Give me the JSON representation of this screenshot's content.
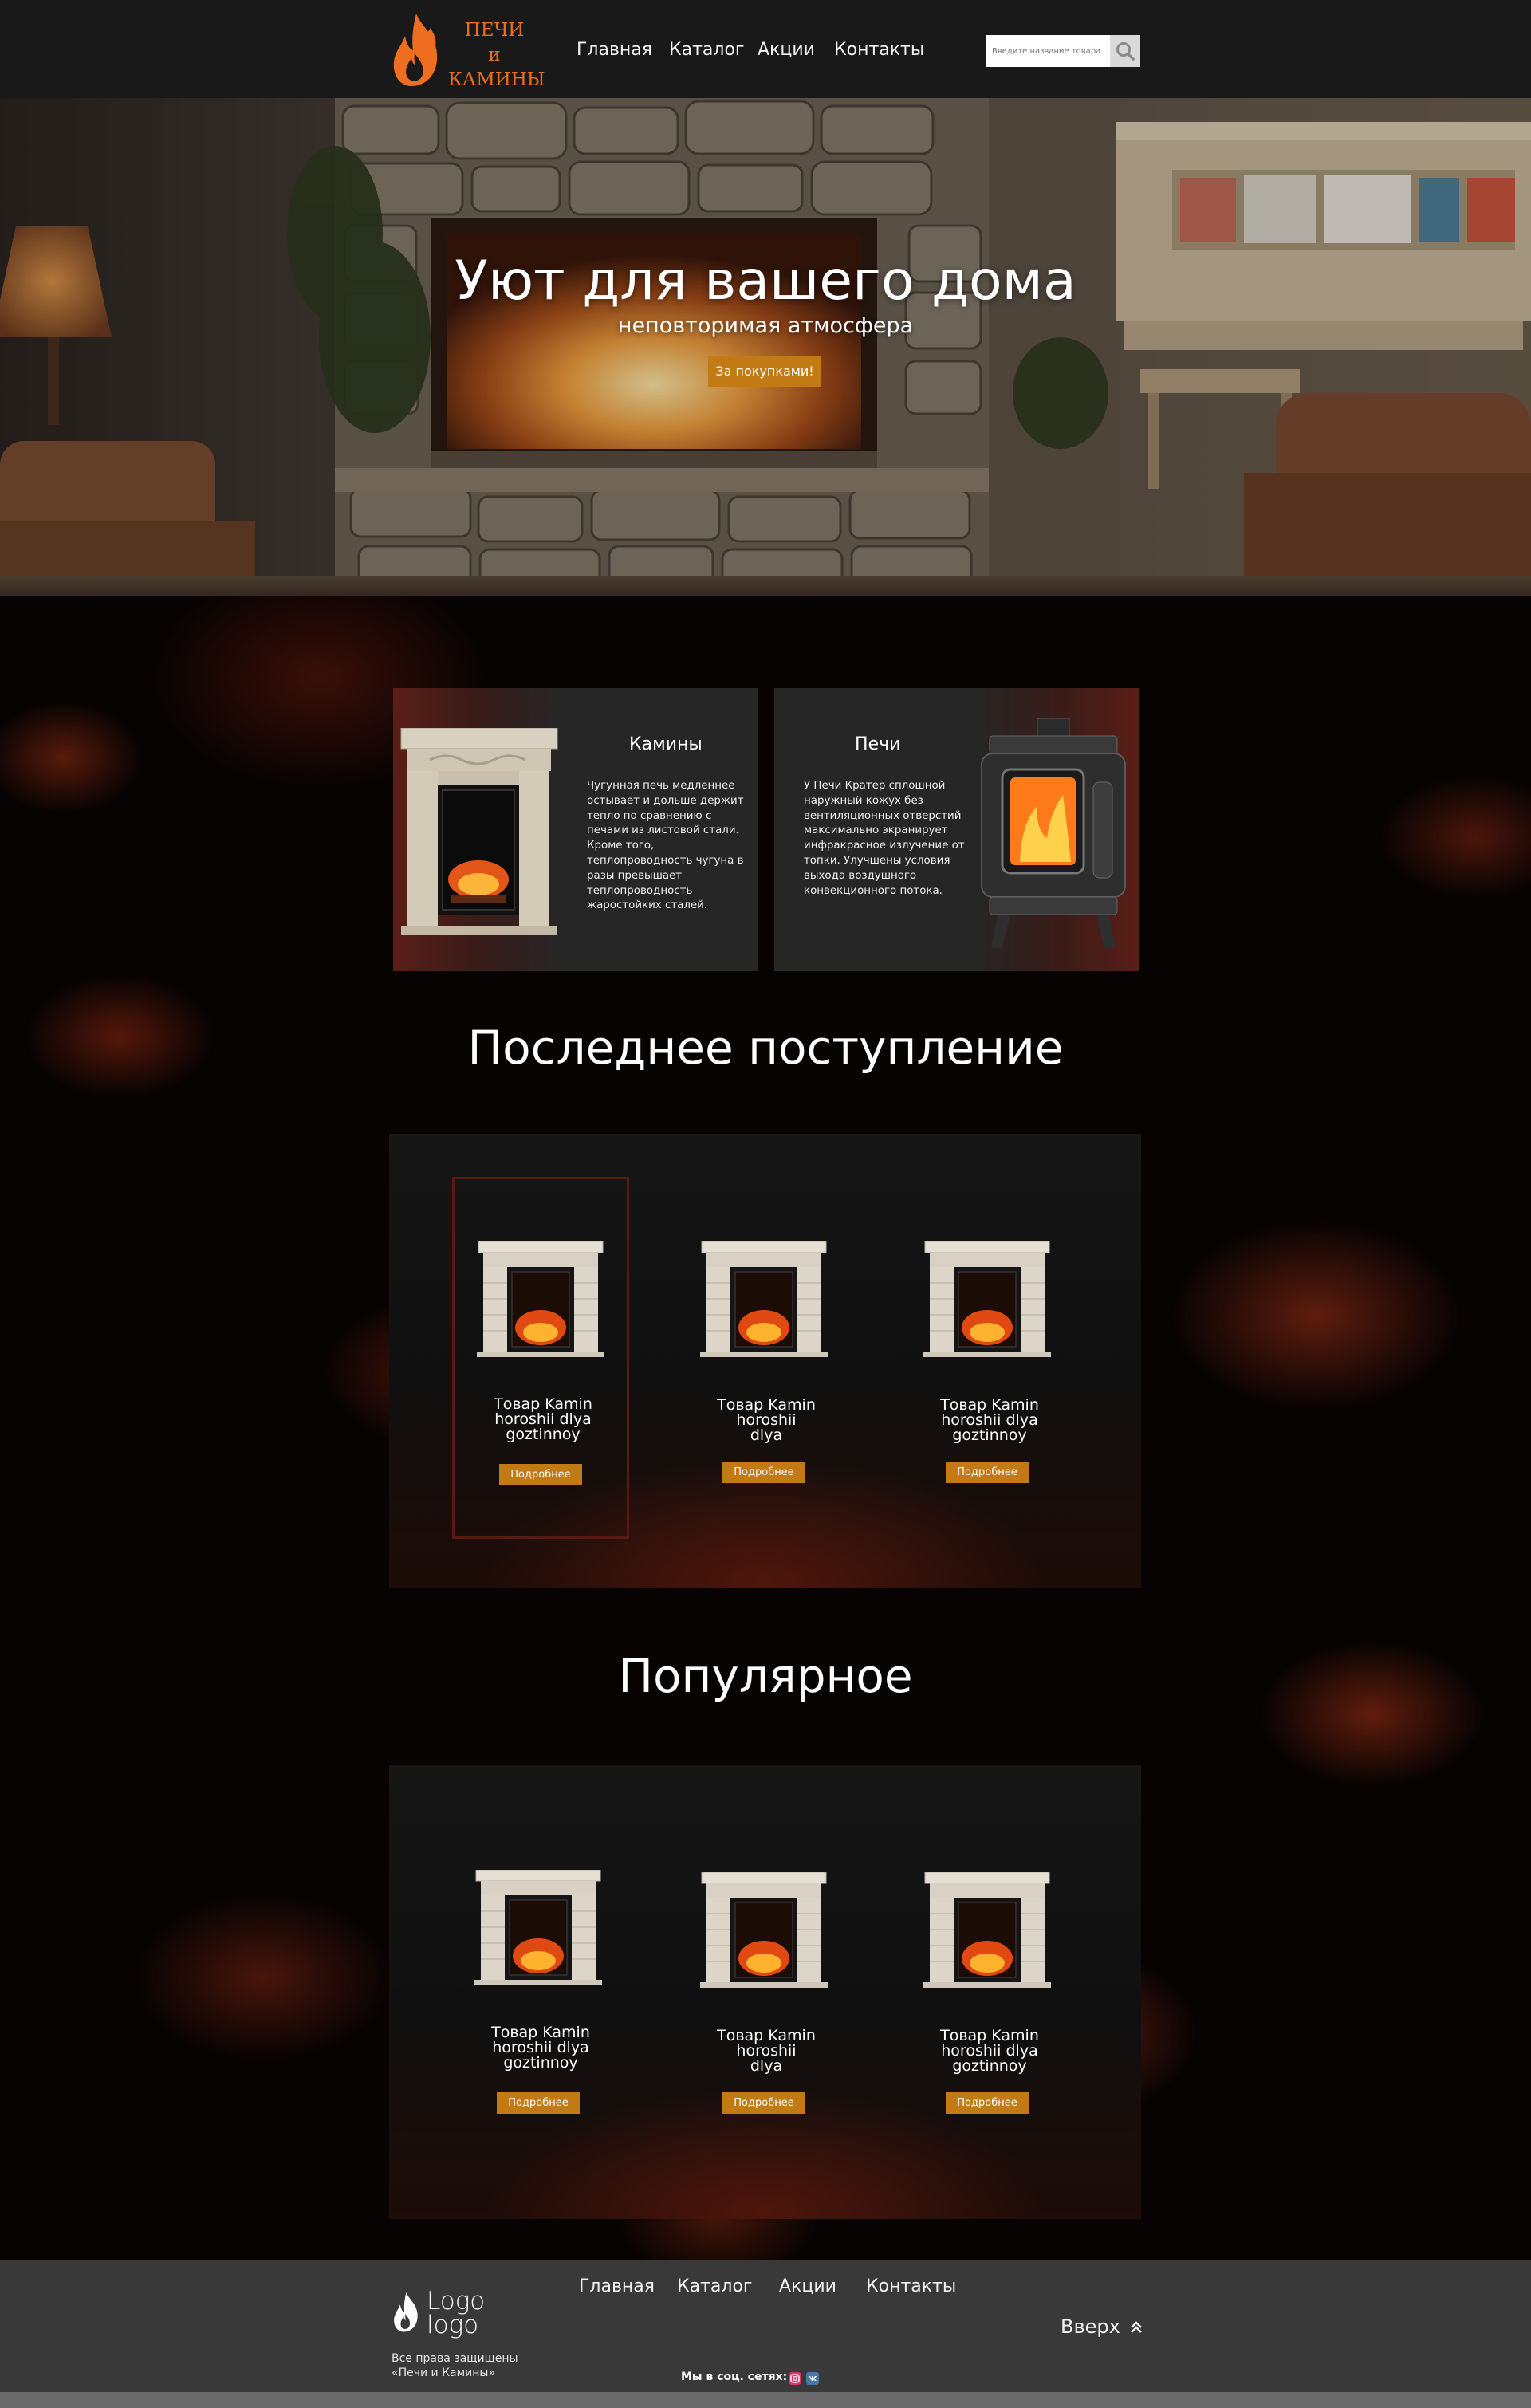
{
  "header": {
    "logo_lines": [
      "ПЕЧИ",
      "и",
      "КАМИНЫ"
    ],
    "nav": [
      "Главная",
      "Каталог",
      "Акции",
      "Контакты"
    ],
    "search": {
      "placeholder": "Введите название товара..."
    }
  },
  "hero": {
    "title": "Уют для вашего дома",
    "subtitle": "неповторимая атмосфера",
    "button": "За покупками!"
  },
  "categories": [
    {
      "title": "Камины",
      "text": "Чугунная печь медленнее остывает и дольше держит тепло по сравнению с печами из листовой стали. Кроме того, теплопроводность чугуна в разы превышает теплопроводность жаростойких сталей."
    },
    {
      "title": "Печи",
      "text": "У Печи Кратер сплошной наружный кожух без вентиляционных отверстий максимально экранирует инфракрасное излучение от топки. Улучшены условия выхода воздушного конвекционного потока."
    }
  ],
  "latest": {
    "title": "Последнее поступление",
    "products": [
      {
        "name_lines": [
          "Товар Kamin",
          "horoshii dlya",
          "goztinnoy"
        ],
        "button": "Подробнее",
        "highlighted": true
      },
      {
        "name_lines": [
          "Товар Kamin",
          "horoshii",
          "dlya"
        ],
        "button": "Подробнее",
        "highlighted": false
      },
      {
        "name_lines": [
          "Товар Kamin",
          "horoshii dlya",
          "goztinnoy"
        ],
        "button": "Подробнее",
        "highlighted": false
      }
    ]
  },
  "popular": {
    "title": "Популярное",
    "products": [
      {
        "name_lines": [
          "Товар Kamin",
          "horoshii dlya",
          "goztinnoy"
        ],
        "button": "Подробнее"
      },
      {
        "name_lines": [
          "Товар Kamin",
          "horoshii",
          "dlya"
        ],
        "button": "Подробнее"
      },
      {
        "name_lines": [
          "Товар Kamin",
          "horoshii dlya",
          "goztinnoy"
        ],
        "button": "Подробнее"
      }
    ]
  },
  "footer": {
    "nav": [
      "Главная",
      "Каталог",
      "Акции",
      "Контакты"
    ],
    "logo_lines": [
      "Logo",
      "logo"
    ],
    "copyright_lines": [
      "Все права защищены",
      "«Печи и Камины»"
    ],
    "social_label": "Мы в соц. сетях:",
    "social_icons": [
      "instagram-icon",
      "vk-icon"
    ],
    "back_to_top": "Вверх"
  },
  "colors": {
    "accent": "#c27a15",
    "logo_orange": "#ee6d1f",
    "header_bg": "#191919",
    "footer_bg": "#393939",
    "card_bg": "#262626"
  }
}
